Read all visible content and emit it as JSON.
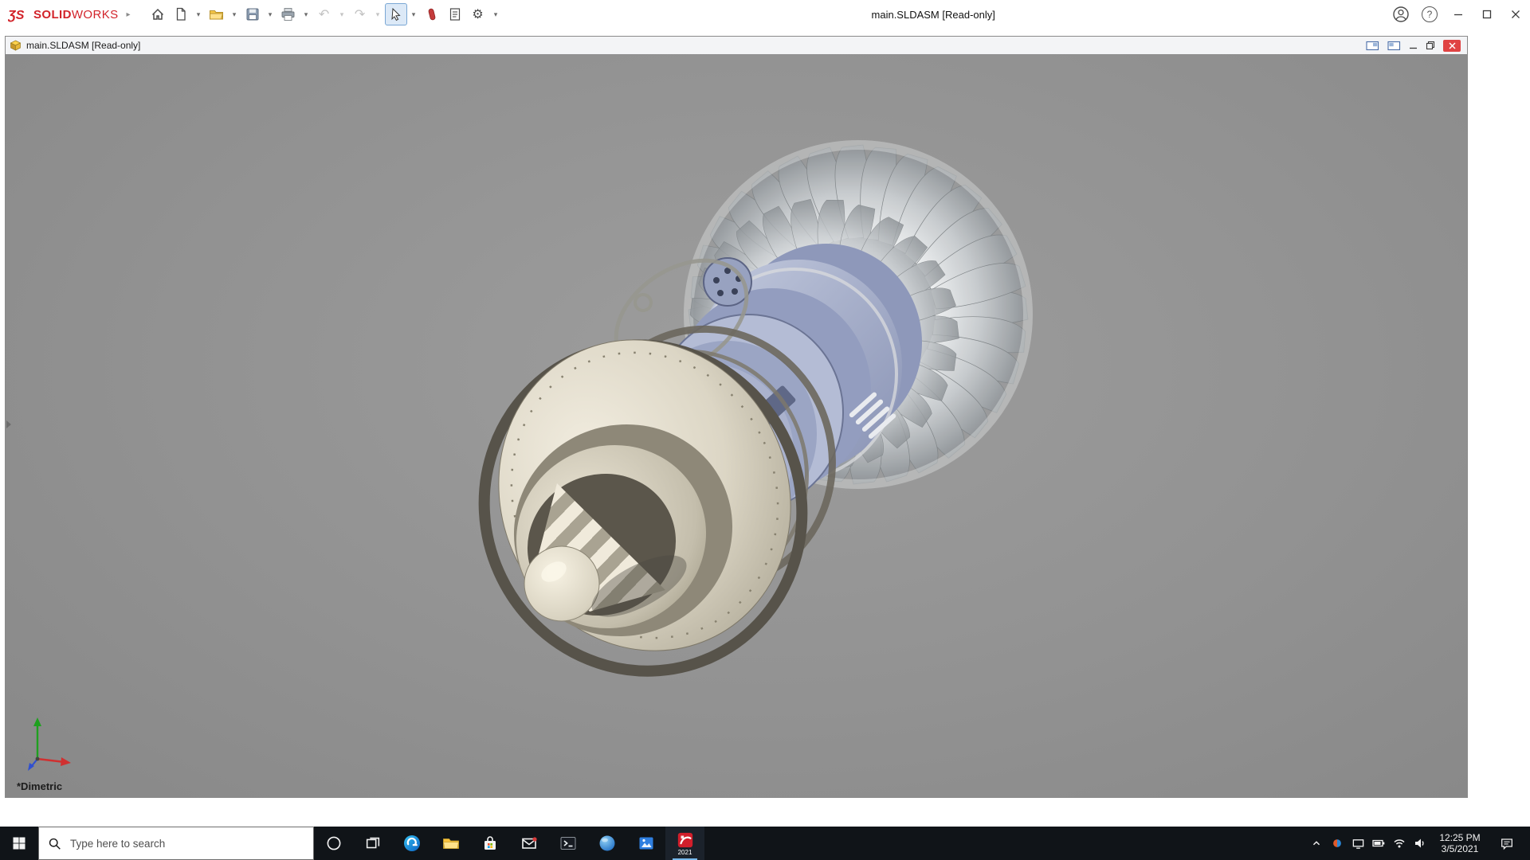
{
  "app_titlebar": {
    "brand_mark": "3DS",
    "brand_mark_glyph": "ƷS",
    "brand_bold": "SOLID",
    "brand_light": "WORKS",
    "logo_flyout_glyph": "▸",
    "window_title": "main.SLDASM [Read-only]",
    "dropdown_glyph": "▾",
    "undo_glyph": "↶",
    "redo_glyph": "↷",
    "options_glyph": "⚙",
    "help_glyph": "?",
    "toolbar_icons": [
      {
        "name": "home",
        "dropdown": false,
        "disabled": false
      },
      {
        "name": "new-document",
        "dropdown": true,
        "disabled": false
      },
      {
        "name": "open",
        "dropdown": true,
        "disabled": false
      },
      {
        "name": "save",
        "dropdown": true,
        "disabled": false
      },
      {
        "name": "print",
        "dropdown": true,
        "disabled": false
      },
      {
        "name": "undo",
        "dropdown": true,
        "disabled": true
      },
      {
        "name": "redo",
        "dropdown": true,
        "disabled": true
      },
      {
        "name": "select-arrow",
        "dropdown": true,
        "disabled": false,
        "active": true
      },
      {
        "name": "red-tool",
        "dropdown": false,
        "disabled": false
      },
      {
        "name": "file-properties",
        "dropdown": false,
        "disabled": false
      },
      {
        "name": "options-gear",
        "dropdown": true,
        "disabled": false
      }
    ],
    "right_controls": [
      "account",
      "help",
      "minimize",
      "maximize",
      "close"
    ]
  },
  "document_window": {
    "title": "main.SLDASM [Read-only]",
    "controls": [
      "pane-left",
      "pane-right",
      "minimize",
      "restore",
      "close"
    ]
  },
  "viewport": {
    "view_orientation_label": "*Dimetric",
    "model": "jet-engine-assembly",
    "triad_axes": [
      "x-red",
      "y-green",
      "z-blue"
    ],
    "background_color": "#919191",
    "model_colors": {
      "body": "#ddd7c6",
      "casing": "#a6afcc",
      "blades": "#d3d6d9"
    }
  },
  "taskbar": {
    "search_placeholder": "Type here to search",
    "icons": [
      "start",
      "cortana",
      "task-view",
      "edge",
      "file-explorer",
      "store",
      "mail",
      "terminal",
      "blue-sphere",
      "photos",
      "solidworks"
    ],
    "solidworks_badge": "2021",
    "tray_icons": [
      "hidden-icons-chevron",
      "color-dot",
      "display",
      "battery",
      "network",
      "volume"
    ],
    "clock": {
      "time": "12:25 PM",
      "date": "3/5/2021"
    },
    "action_center": "notifications"
  }
}
